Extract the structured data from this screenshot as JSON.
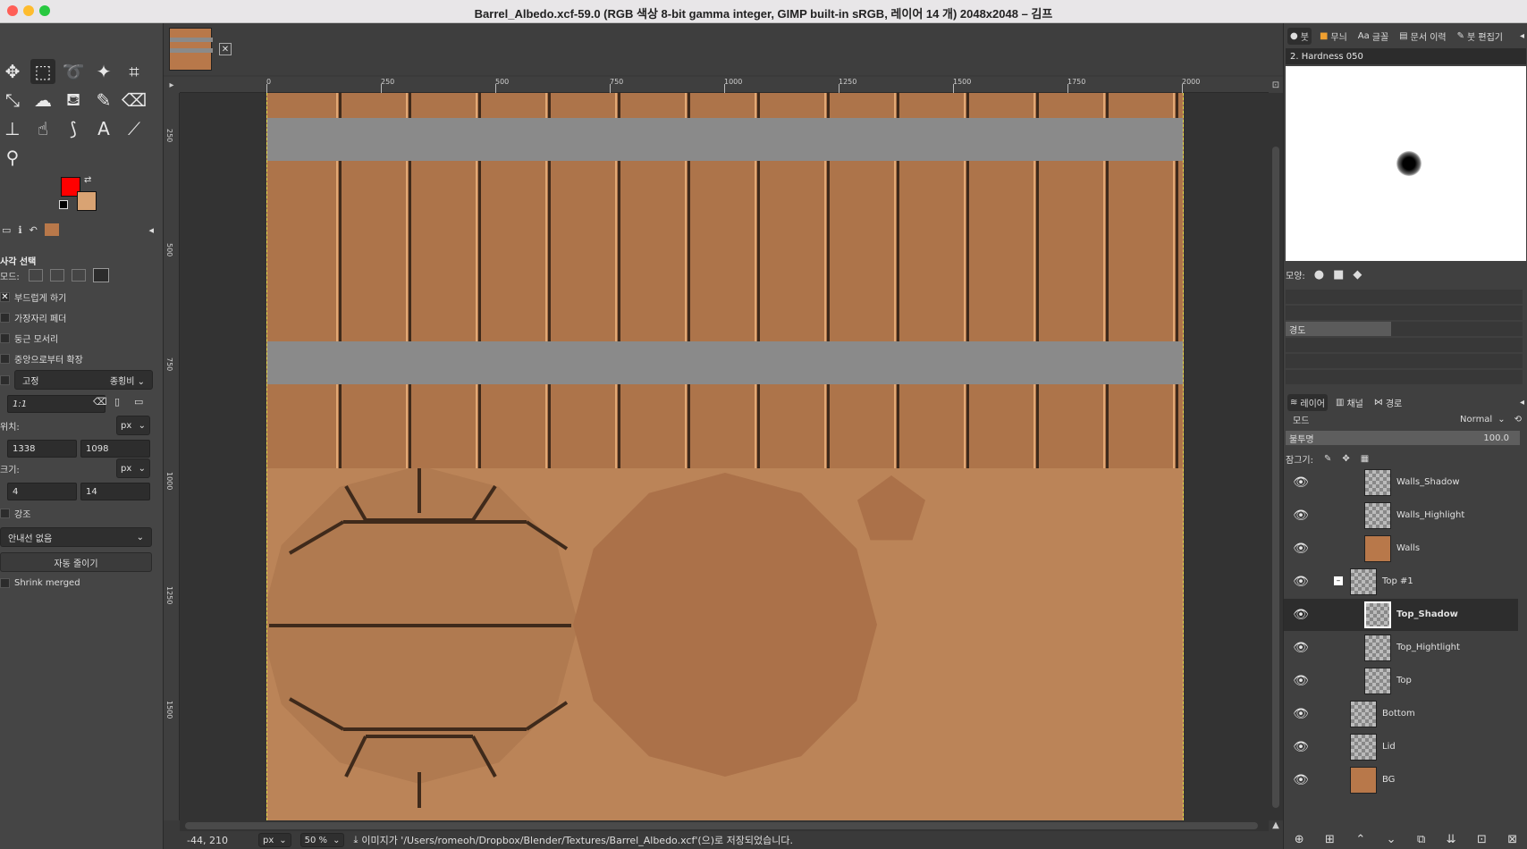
{
  "window": {
    "title": "Barrel_Albedo.xcf-59.0 (RGB 색상 8-bit gamma integer, GIMP built-in sRGB, 레이어 14 개) 2048x2048 – 김프"
  },
  "toolbox": {
    "tools": [
      {
        "name": "move-tool-icon",
        "glyph": "✥"
      },
      {
        "name": "rect-select-tool-icon",
        "glyph": "⬚"
      },
      {
        "name": "lasso-tool-icon",
        "glyph": "➰"
      },
      {
        "name": "fuzzy-select-tool-icon",
        "glyph": "✦"
      },
      {
        "name": "crop-tool-icon",
        "glyph": "⌗"
      },
      {
        "name": "transform-tool-icon",
        "glyph": "⤡"
      },
      {
        "name": "warp-tool-icon",
        "glyph": "☁"
      },
      {
        "name": "bucket-fill-tool-icon",
        "glyph": "⛾"
      },
      {
        "name": "paintbrush-tool-icon",
        "glyph": "✎"
      },
      {
        "name": "eraser-tool-icon",
        "glyph": "⌫"
      },
      {
        "name": "clone-tool-icon",
        "glyph": "⊥"
      },
      {
        "name": "smudge-tool-icon",
        "glyph": "☝"
      },
      {
        "name": "paths-tool-icon",
        "glyph": "⟆"
      },
      {
        "name": "text-tool-icon",
        "glyph": "A"
      },
      {
        "name": "color-picker-tool-icon",
        "glyph": "⟋"
      },
      {
        "name": "zoom-tool-icon",
        "glyph": "⚲"
      }
    ],
    "fg_color": "#ff0000",
    "bg_color": "#d9a373"
  },
  "tool_options": {
    "title": "사각 선택",
    "mode_label": "모드:",
    "antialias": "부드럽게 하기",
    "feather_edges": "가장자리 페더",
    "rounded_corners": "둥근 모서리",
    "expand_from_center": "중앙으로부터 확장",
    "fixed_label": "고정",
    "fixed_value": "종횡비",
    "ratio_value": "1:1",
    "position_label": "위치:",
    "position_unit": "px",
    "position_x": "1338",
    "position_y": "1098",
    "size_label": "크기:",
    "size_unit": "px",
    "size_w": "4",
    "size_h": "14",
    "highlight": "강조",
    "guides": "안내선 없음",
    "auto_shrink": "자동 줄이기",
    "shrink_merged": "Shrink merged"
  },
  "ruler": {
    "top": [
      "0",
      "250",
      "500",
      "750",
      "1000",
      "1250",
      "1500",
      "1750",
      "2000"
    ],
    "left": [
      "250",
      "500",
      "750",
      "1000",
      "1250",
      "1500"
    ]
  },
  "statusbar": {
    "coords": "-44, 210",
    "unit": "px",
    "zoom": "50 %",
    "message": "이미지가 '/Users/romeoh/Dropbox/Blender/Textures/Barrel_Albedo.xcf'(으)로 저장되었습니다."
  },
  "right_dock": {
    "tabs": [
      "붓",
      "무늬",
      "글꼴",
      "문서 이력",
      "붓 편집기"
    ],
    "brush_name": "2. Hardness 050",
    "shape_label": "모양:",
    "hardness_label": "경도",
    "layers_tabs": [
      "레이어",
      "채널",
      "경로"
    ],
    "mode_label": "모드",
    "mode_value": "Normal",
    "opacity_label": "불투명",
    "opacity_value": "100.0",
    "lock_label": "잠그기:",
    "layers": [
      {
        "name": "Walls_Shadow",
        "indent": 2,
        "thumb": "checker"
      },
      {
        "name": "Walls_Highlight",
        "indent": 2,
        "thumb": "checker"
      },
      {
        "name": "Walls",
        "indent": 2,
        "thumb": "solid"
      },
      {
        "name": "Top #1",
        "indent": 1,
        "thumb": "checker",
        "group": true
      },
      {
        "name": "Top_Shadow",
        "indent": 2,
        "thumb": "checker",
        "active": true
      },
      {
        "name": "Top_Hightlight",
        "indent": 2,
        "thumb": "checker"
      },
      {
        "name": "Top",
        "indent": 2,
        "thumb": "checker"
      },
      {
        "name": "Bottom",
        "indent": 1,
        "thumb": "checker"
      },
      {
        "name": "Lid",
        "indent": 1,
        "thumb": "checker"
      },
      {
        "name": "BG",
        "indent": 1,
        "thumb": "solid"
      }
    ]
  },
  "colors": {
    "plank": "#ad744a",
    "plank_bg": "#bb8458",
    "band": "#8a8a8a",
    "lid": "#b07a50"
  }
}
